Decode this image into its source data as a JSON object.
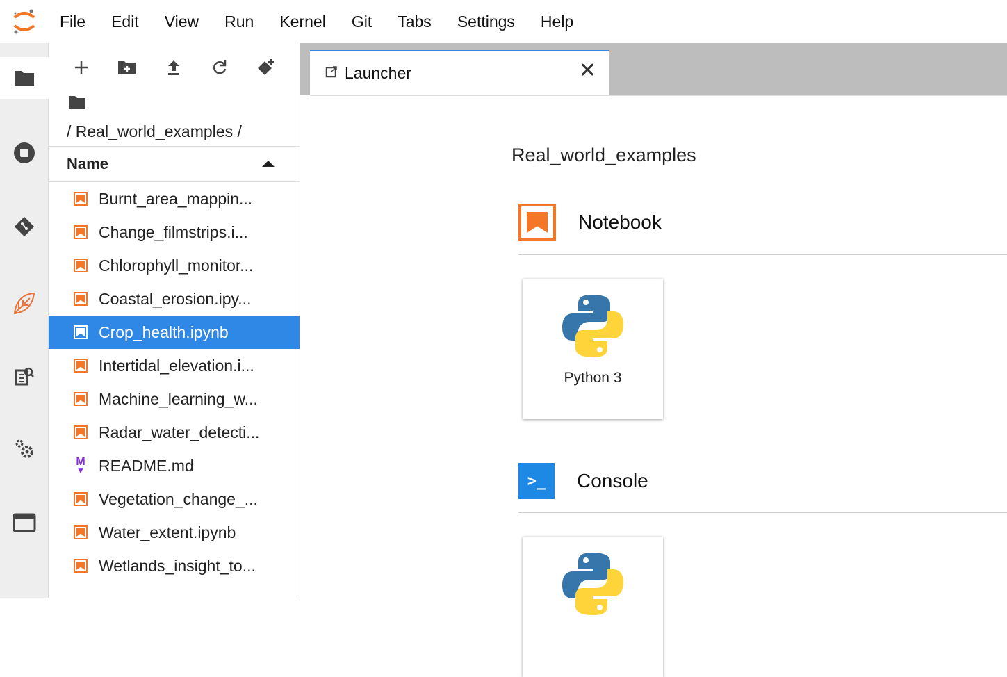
{
  "menubar": {
    "items": [
      "File",
      "Edit",
      "View",
      "Run",
      "Kernel",
      "Git",
      "Tabs",
      "Settings",
      "Help"
    ]
  },
  "activity_bar": {
    "icons": [
      "folder-icon",
      "stop-circle-icon",
      "git-icon",
      "extension-leaf-icon",
      "property-inspector-icon",
      "settings-icon",
      "tabs-icon"
    ]
  },
  "file_browser": {
    "toolbar": [
      "new-launcher-icon",
      "new-folder-icon",
      "upload-icon",
      "refresh-icon",
      "git-clone-icon"
    ],
    "breadcrumb": "/ Real_world_examples /",
    "column_header": "Name",
    "files": [
      {
        "name": "Burnt_area_mappin...",
        "type": "notebook",
        "selected": false
      },
      {
        "name": "Change_filmstrips.i...",
        "type": "notebook",
        "selected": false
      },
      {
        "name": "Chlorophyll_monitor...",
        "type": "notebook",
        "selected": false
      },
      {
        "name": "Coastal_erosion.ipy...",
        "type": "notebook",
        "selected": false
      },
      {
        "name": "Crop_health.ipynb",
        "type": "notebook",
        "selected": true
      },
      {
        "name": "Intertidal_elevation.i...",
        "type": "notebook",
        "selected": false
      },
      {
        "name": "Machine_learning_w...",
        "type": "notebook",
        "selected": false
      },
      {
        "name": "Radar_water_detecti...",
        "type": "notebook",
        "selected": false
      },
      {
        "name": "README.md",
        "type": "markdown",
        "selected": false
      },
      {
        "name": "Vegetation_change_...",
        "type": "notebook",
        "selected": false
      },
      {
        "name": "Water_extent.ipynb",
        "type": "notebook",
        "selected": false
      },
      {
        "name": "Wetlands_insight_to...",
        "type": "notebook",
        "selected": false
      }
    ]
  },
  "main": {
    "tab": {
      "label": "Launcher",
      "close": "✕"
    },
    "cwd": "Real_world_examples",
    "notebook_section": {
      "title": "Notebook",
      "card_label": "Python 3"
    },
    "console_section": {
      "title": "Console",
      "icon_text": ">_"
    }
  },
  "colors": {
    "accent": "#2f88e5",
    "notebook_orange": "#f37726",
    "markdown_purple": "#8a2be2"
  }
}
